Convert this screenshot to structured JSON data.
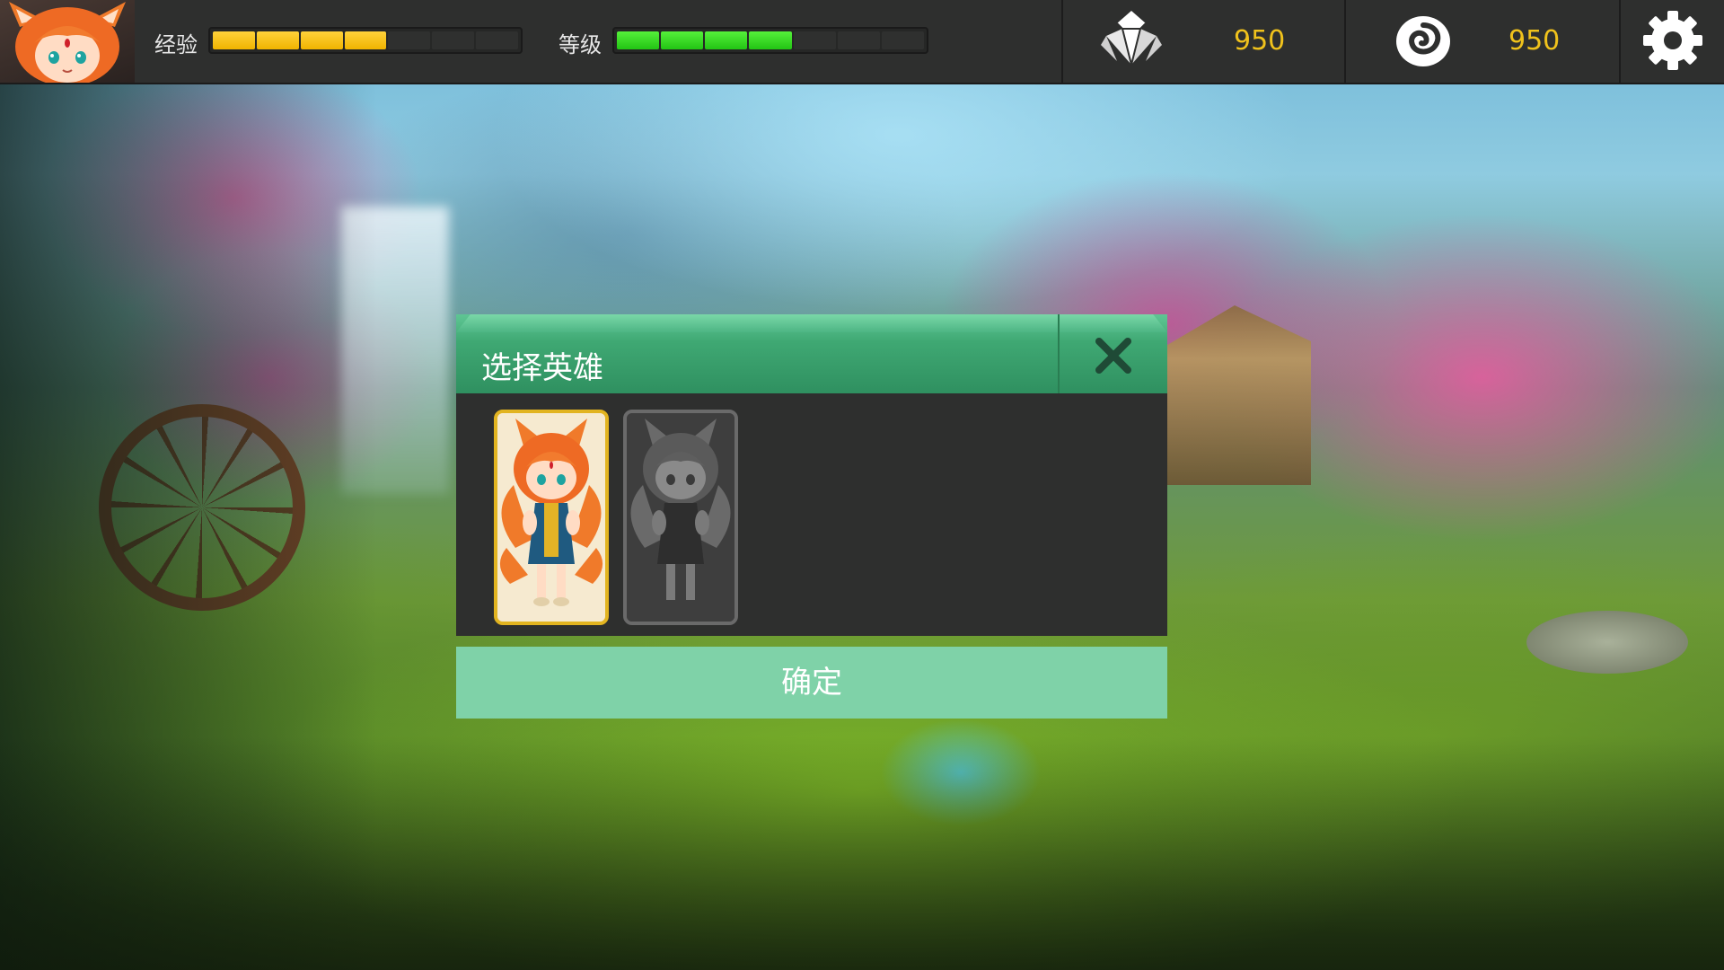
{
  "hud": {
    "exp_label": "经验",
    "exp_progress_segments": 4,
    "exp_total_segments": 7,
    "level_label": "等级",
    "level_progress_segments": 4,
    "level_total_segments": 7,
    "crystal_icon": "crystal-icon",
    "crystal_value": "950",
    "swirl_icon": "swirl-coin-icon",
    "swirl_value": "950",
    "settings_icon": "gear-icon"
  },
  "dialog": {
    "title": "选择英雄",
    "close_icon": "close-icon",
    "confirm_label": "确定",
    "heroes": [
      {
        "name": "fox-girl-hero",
        "state": "selected"
      },
      {
        "name": "fox-girl-hero",
        "state": "locked"
      }
    ]
  },
  "colors": {
    "exp_bar": "#f5c400",
    "level_bar": "#33dd22",
    "currency_text": "#f0c21c",
    "dialog_header": "#3fa873",
    "dialog_body": "#2e2f2e",
    "confirm_button": "#7fd2a8",
    "selected_frame": "#e2b420"
  }
}
